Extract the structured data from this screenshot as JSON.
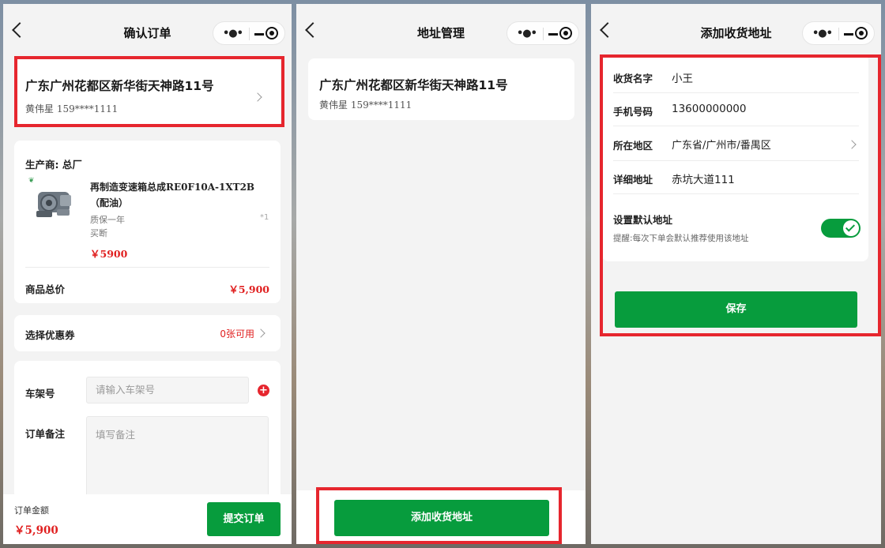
{
  "screen1": {
    "title": "确认订单",
    "address": {
      "line": "广东广州花都区新华街天神路11号",
      "name": "黄伟星",
      "phone": "159****1111"
    },
    "order": {
      "manufacturer": "生产商: 总厂",
      "product_name_1": "再制造变速箱总成RE0F10A-1XT2B",
      "product_name_2": "（配油）",
      "tag1": "质保一年",
      "tag2": "买断",
      "qty": "*1",
      "price": "￥5900",
      "total_label": "商品总价",
      "total_value": "￥5,900"
    },
    "coupon": {
      "label": "选择优惠券",
      "value": "0张可用"
    },
    "form": {
      "vin_label": "车架号",
      "vin_placeholder": "请输入车架号",
      "note_label": "订单备注",
      "note_placeholder": "填写备注"
    },
    "footer": {
      "amount_label": "订单金额",
      "amount_value": "￥5,900",
      "submit_label": "提交订单"
    }
  },
  "screen2": {
    "title": "地址管理",
    "address": {
      "line": "广东广州花都区新华街天神路11号",
      "name": "黄伟星",
      "phone": "159****1111"
    },
    "add_button": "添加收货地址"
  },
  "screen3": {
    "title": "添加收货地址",
    "fields": [
      {
        "label": "收货名字",
        "value": "小王"
      },
      {
        "label": "手机号码",
        "value": "13600000000"
      },
      {
        "label": "所在地区",
        "value": "广东省/广州市/番禺区"
      },
      {
        "label": "详细地址",
        "value": "赤坑大道111"
      }
    ],
    "default_label": "设置默认地址",
    "default_hint": "提醒:每次下单会默认推荐使用该地址",
    "default_on": true,
    "save_label": "保存"
  },
  "colors": {
    "accent_green": "#079c3d",
    "highlight_red": "#e6262e",
    "price_red": "#e02020"
  }
}
